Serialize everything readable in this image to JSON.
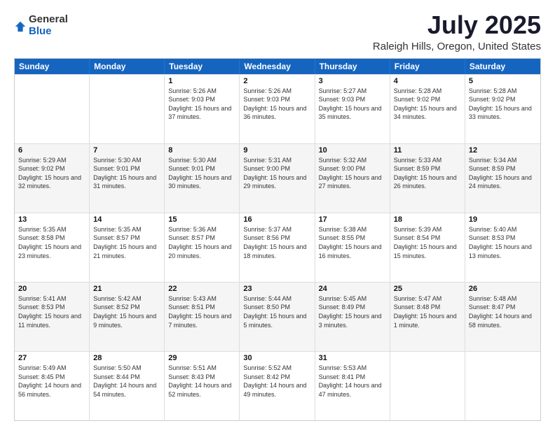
{
  "logo": {
    "general": "General",
    "blue": "Blue"
  },
  "title": "July 2025",
  "subtitle": "Raleigh Hills, Oregon, United States",
  "header_days": [
    "Sunday",
    "Monday",
    "Tuesday",
    "Wednesday",
    "Thursday",
    "Friday",
    "Saturday"
  ],
  "weeks": [
    {
      "alt": false,
      "cells": [
        {
          "day": "",
          "info": ""
        },
        {
          "day": "",
          "info": ""
        },
        {
          "day": "1",
          "info": "Sunrise: 5:26 AM\nSunset: 9:03 PM\nDaylight: 15 hours and 37 minutes."
        },
        {
          "day": "2",
          "info": "Sunrise: 5:26 AM\nSunset: 9:03 PM\nDaylight: 15 hours and 36 minutes."
        },
        {
          "day": "3",
          "info": "Sunrise: 5:27 AM\nSunset: 9:03 PM\nDaylight: 15 hours and 35 minutes."
        },
        {
          "day": "4",
          "info": "Sunrise: 5:28 AM\nSunset: 9:02 PM\nDaylight: 15 hours and 34 minutes."
        },
        {
          "day": "5",
          "info": "Sunrise: 5:28 AM\nSunset: 9:02 PM\nDaylight: 15 hours and 33 minutes."
        }
      ]
    },
    {
      "alt": true,
      "cells": [
        {
          "day": "6",
          "info": "Sunrise: 5:29 AM\nSunset: 9:02 PM\nDaylight: 15 hours and 32 minutes."
        },
        {
          "day": "7",
          "info": "Sunrise: 5:30 AM\nSunset: 9:01 PM\nDaylight: 15 hours and 31 minutes."
        },
        {
          "day": "8",
          "info": "Sunrise: 5:30 AM\nSunset: 9:01 PM\nDaylight: 15 hours and 30 minutes."
        },
        {
          "day": "9",
          "info": "Sunrise: 5:31 AM\nSunset: 9:00 PM\nDaylight: 15 hours and 29 minutes."
        },
        {
          "day": "10",
          "info": "Sunrise: 5:32 AM\nSunset: 9:00 PM\nDaylight: 15 hours and 27 minutes."
        },
        {
          "day": "11",
          "info": "Sunrise: 5:33 AM\nSunset: 8:59 PM\nDaylight: 15 hours and 26 minutes."
        },
        {
          "day": "12",
          "info": "Sunrise: 5:34 AM\nSunset: 8:59 PM\nDaylight: 15 hours and 24 minutes."
        }
      ]
    },
    {
      "alt": false,
      "cells": [
        {
          "day": "13",
          "info": "Sunrise: 5:35 AM\nSunset: 8:58 PM\nDaylight: 15 hours and 23 minutes."
        },
        {
          "day": "14",
          "info": "Sunrise: 5:35 AM\nSunset: 8:57 PM\nDaylight: 15 hours and 21 minutes."
        },
        {
          "day": "15",
          "info": "Sunrise: 5:36 AM\nSunset: 8:57 PM\nDaylight: 15 hours and 20 minutes."
        },
        {
          "day": "16",
          "info": "Sunrise: 5:37 AM\nSunset: 8:56 PM\nDaylight: 15 hours and 18 minutes."
        },
        {
          "day": "17",
          "info": "Sunrise: 5:38 AM\nSunset: 8:55 PM\nDaylight: 15 hours and 16 minutes."
        },
        {
          "day": "18",
          "info": "Sunrise: 5:39 AM\nSunset: 8:54 PM\nDaylight: 15 hours and 15 minutes."
        },
        {
          "day": "19",
          "info": "Sunrise: 5:40 AM\nSunset: 8:53 PM\nDaylight: 15 hours and 13 minutes."
        }
      ]
    },
    {
      "alt": true,
      "cells": [
        {
          "day": "20",
          "info": "Sunrise: 5:41 AM\nSunset: 8:53 PM\nDaylight: 15 hours and 11 minutes."
        },
        {
          "day": "21",
          "info": "Sunrise: 5:42 AM\nSunset: 8:52 PM\nDaylight: 15 hours and 9 minutes."
        },
        {
          "day": "22",
          "info": "Sunrise: 5:43 AM\nSunset: 8:51 PM\nDaylight: 15 hours and 7 minutes."
        },
        {
          "day": "23",
          "info": "Sunrise: 5:44 AM\nSunset: 8:50 PM\nDaylight: 15 hours and 5 minutes."
        },
        {
          "day": "24",
          "info": "Sunrise: 5:45 AM\nSunset: 8:49 PM\nDaylight: 15 hours and 3 minutes."
        },
        {
          "day": "25",
          "info": "Sunrise: 5:47 AM\nSunset: 8:48 PM\nDaylight: 15 hours and 1 minute."
        },
        {
          "day": "26",
          "info": "Sunrise: 5:48 AM\nSunset: 8:47 PM\nDaylight: 14 hours and 58 minutes."
        }
      ]
    },
    {
      "alt": false,
      "cells": [
        {
          "day": "27",
          "info": "Sunrise: 5:49 AM\nSunset: 8:45 PM\nDaylight: 14 hours and 56 minutes."
        },
        {
          "day": "28",
          "info": "Sunrise: 5:50 AM\nSunset: 8:44 PM\nDaylight: 14 hours and 54 minutes."
        },
        {
          "day": "29",
          "info": "Sunrise: 5:51 AM\nSunset: 8:43 PM\nDaylight: 14 hours and 52 minutes."
        },
        {
          "day": "30",
          "info": "Sunrise: 5:52 AM\nSunset: 8:42 PM\nDaylight: 14 hours and 49 minutes."
        },
        {
          "day": "31",
          "info": "Sunrise: 5:53 AM\nSunset: 8:41 PM\nDaylight: 14 hours and 47 minutes."
        },
        {
          "day": "",
          "info": ""
        },
        {
          "day": "",
          "info": ""
        }
      ]
    }
  ]
}
